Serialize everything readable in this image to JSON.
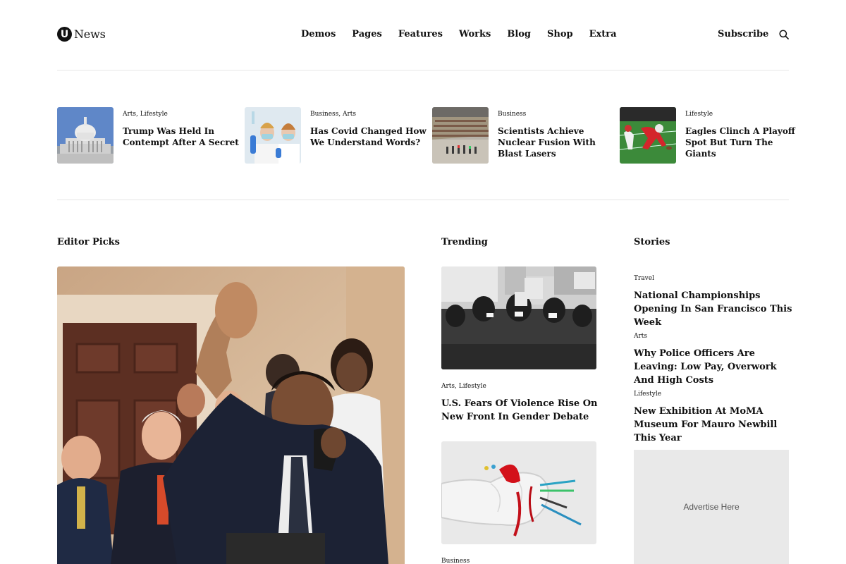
{
  "header": {
    "logo_letter": "U",
    "logo_text": "News",
    "nav": [
      "Demos",
      "Pages",
      "Features",
      "Works",
      "Blog",
      "Shop",
      "Extra"
    ],
    "subscribe_label": "Subscribe"
  },
  "strip": [
    {
      "category": "Arts, Lifestyle",
      "title": "Trump Was Held In Contempt After A Secret",
      "image": "capitol-building"
    },
    {
      "category": "Business, Arts",
      "title": "Has Covid Changed How We Understand Words?",
      "image": "lab-scientists"
    },
    {
      "category": "Business",
      "title": "Scientists Achieve Nuclear Fusion With Blast Lasers",
      "image": "stadium-crowd"
    },
    {
      "category": "Lifestyle",
      "title": "Eagles Clinch A Playoff Spot But Turn The Giants",
      "image": "football-player"
    }
  ],
  "sections": {
    "editor_picks": "Editor Picks",
    "trending": "Trending",
    "stories": "Stories"
  },
  "trending": [
    {
      "category": "Arts, Lifestyle",
      "title": "U.S. Fears Of Violence Rise On New Front In Gender Debate",
      "image": "protest-crowd"
    },
    {
      "category": "Business",
      "title": "",
      "image": "painted-fist"
    }
  ],
  "stories": [
    {
      "category": "Travel",
      "title": "National Championships Opening In San Francisco This Week"
    },
    {
      "category": "Arts",
      "title": "Why Police Officers Are Leaving: Low Pay, Overwork And High Costs"
    },
    {
      "category": "Lifestyle",
      "title": "New Exhibition At MoMA Museum For Mauro Newbill This Year"
    }
  ],
  "ad": {
    "label": "Advertise Here"
  },
  "icons": {
    "search": "search-icon"
  },
  "colors": {
    "text": "#111111",
    "divider": "#e6e6e6",
    "ad_bg": "#e9e9e9"
  }
}
